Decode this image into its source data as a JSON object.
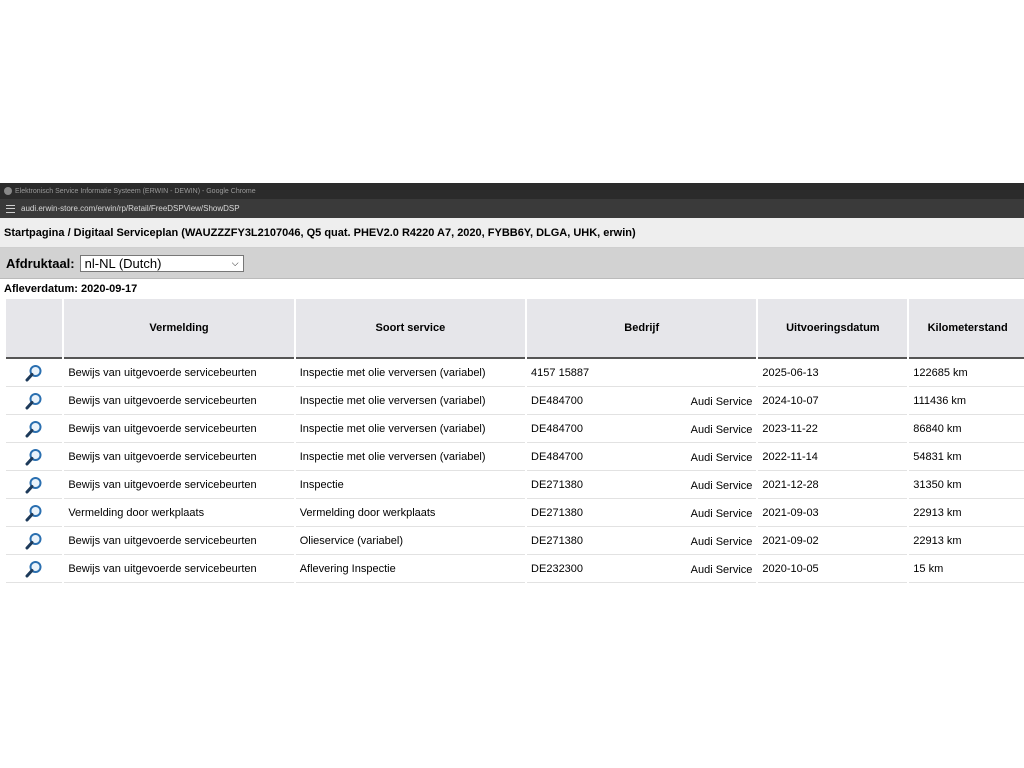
{
  "window": {
    "title": "Elektronisch Service Informatie Systeem (ERWIN - DEWIN) - Google Chrome",
    "url": "audi.erwin-store.com/erwin/rp/Retail/FreeDSPView/ShowDSP"
  },
  "breadcrumb": "Startpagina / Digitaal Serviceplan (WAUZZZFY3L2107046, Q5 quat. PHEV2.0 R4220 A7, 2020, FYBB6Y, DLGA, UHK, erwin)",
  "language": {
    "label": "Afdruktaal:",
    "selected": "nl-NL (Dutch)"
  },
  "delivery_date": "Afleverdatum: 2020-09-17",
  "table": {
    "headers": [
      "Vermelding",
      "Soort service",
      "Bedrijf",
      "Uitvoeringsdatum",
      "Kilometerstand"
    ],
    "rows": [
      {
        "entry": "Bewijs van uitgevoerde servicebeurten",
        "service": "Inspectie met olie verversen (variabel)",
        "company_id": "4157 15887",
        "company_name": "",
        "date": "2025-06-13",
        "km": "122685 km"
      },
      {
        "entry": "Bewijs van uitgevoerde servicebeurten",
        "service": "Inspectie met olie verversen (variabel)",
        "company_id": "DE484700",
        "company_name": "Audi Service",
        "date": "2024-10-07",
        "km": "111436 km"
      },
      {
        "entry": "Bewijs van uitgevoerde servicebeurten",
        "service": "Inspectie met olie verversen (variabel)",
        "company_id": "DE484700",
        "company_name": "Audi Service",
        "date": "2023-11-22",
        "km": "86840 km"
      },
      {
        "entry": "Bewijs van uitgevoerde servicebeurten",
        "service": "Inspectie met olie verversen (variabel)",
        "company_id": "DE484700",
        "company_name": "Audi Service",
        "date": "2022-11-14",
        "km": "54831 km"
      },
      {
        "entry": "Bewijs van uitgevoerde servicebeurten",
        "service": "Inspectie",
        "company_id": "DE271380",
        "company_name": "Audi Service",
        "date": "2021-12-28",
        "km": "31350 km"
      },
      {
        "entry": "Vermelding door werkplaats",
        "service": "Vermelding door werkplaats",
        "company_id": "DE271380",
        "company_name": "Audi Service",
        "date": "2021-09-03",
        "km": "22913 km"
      },
      {
        "entry": "Bewijs van uitgevoerde servicebeurten",
        "service": "Olieservice (variabel)",
        "company_id": "DE271380",
        "company_name": "Audi Service",
        "date": "2021-09-02",
        "km": "22913 km"
      },
      {
        "entry": "Bewijs van uitgevoerde servicebeurten",
        "service": "Aflevering Inspectie",
        "company_id": "DE232300",
        "company_name": "Audi Service",
        "date": "2020-10-05",
        "km": "15 km"
      }
    ]
  },
  "icons": {
    "row_view": "magnifier-icon",
    "url_settings": "tune-icon",
    "chrome": "chrome-icon"
  },
  "colors": {
    "titlebar": "#2b2b2b",
    "urlbar": "#3a3a3a",
    "header_bg": "#e6e6ea",
    "magnifier": "#2a6fb0"
  }
}
